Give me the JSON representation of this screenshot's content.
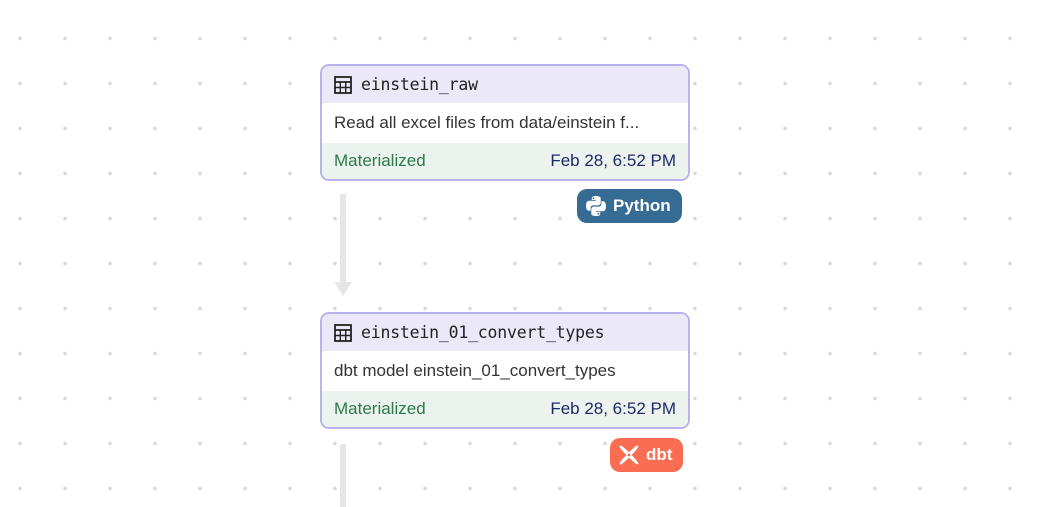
{
  "colors": {
    "node_border": "#b8b3ea",
    "node_header_bg": "#ebe9f8",
    "status_bg": "#ecf3ef",
    "status_text": "#2c7a4b",
    "timestamp_text": "#1e2a66",
    "python_badge": "#366b94",
    "dbt_badge": "#fb6d52",
    "edge": "#e6e6e6"
  },
  "nodes": [
    {
      "icon": "table-icon",
      "title": "einstein_raw",
      "description": "Read all excel files from data/einstein f...",
      "status": "Materialized",
      "timestamp": "Feb 28, 6:52 PM",
      "badge": {
        "icon": "python-logo-icon",
        "label": "Python"
      }
    },
    {
      "icon": "table-icon",
      "title": "einstein_01_convert_types",
      "description": "dbt model einstein_01_convert_types",
      "status": "Materialized",
      "timestamp": "Feb 28, 6:52 PM",
      "badge": {
        "icon": "dbt-logo-icon",
        "label": "dbt"
      }
    }
  ]
}
